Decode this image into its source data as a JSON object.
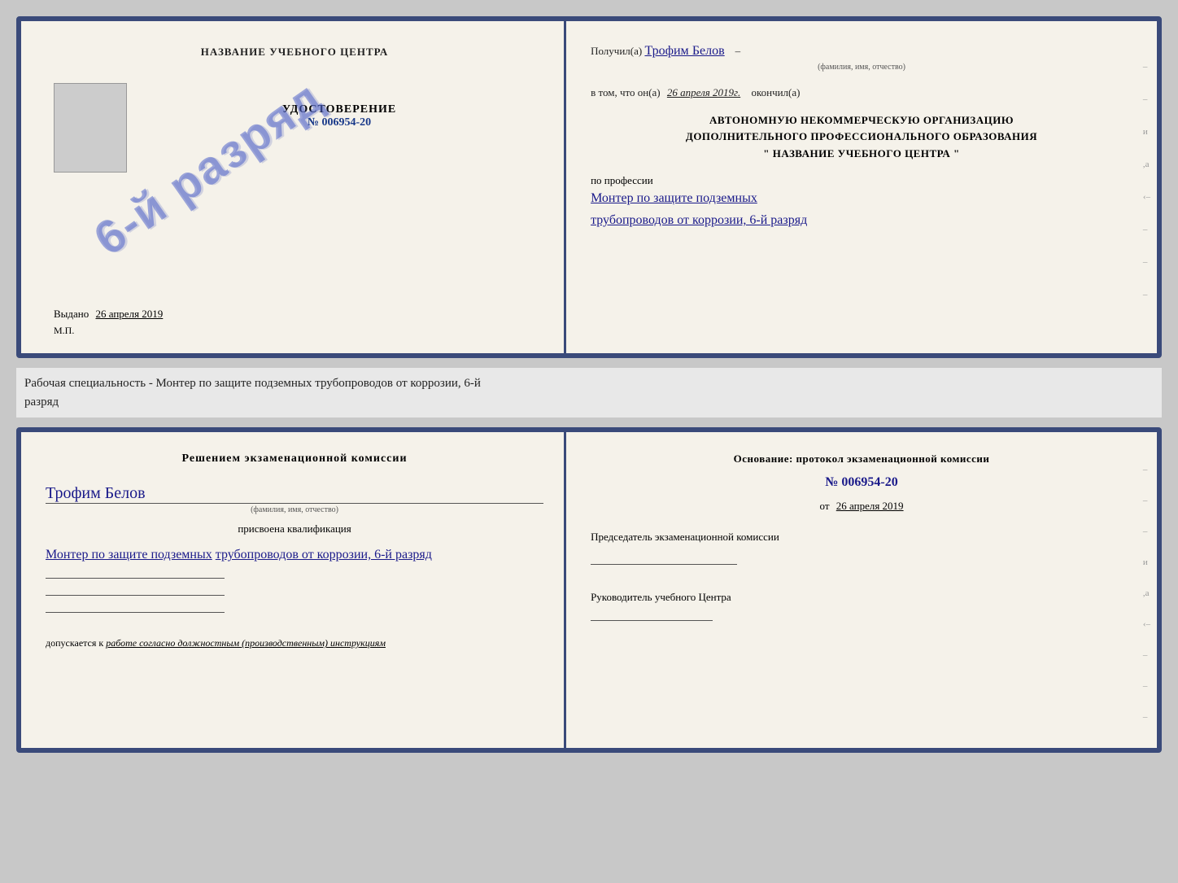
{
  "page": {
    "background": "#c8c8c8"
  },
  "top_cert": {
    "left": {
      "title": "НАЗВАНИЕ УЧЕБНОГО ЦЕНТРА",
      "stamp_text": "6-й разряд",
      "udostoverenie_label": "УДОСТОВЕРЕНИЕ",
      "number": "№ 006954-20",
      "vydano_label": "Выдано",
      "vydano_date": "26 апреля 2019",
      "mp_label": "М.П."
    },
    "right": {
      "poluchil_label": "Получил(a)",
      "recipient_name": "Трофим Белов",
      "fio_caption": "(фамилия, имя, отчество)",
      "vtom_label": "в том, что он(а)",
      "date_value": "26 апреля 2019г.",
      "okonchil_label": "окончил(а)",
      "org_line1": "АВТОНОМНУЮ НЕКОММЕРЧЕСКУЮ ОРГАНИЗАЦИЮ",
      "org_line2": "ДОПОЛНИТЕЛЬНОГО ПРОФЕССИОНАЛЬНОГО ОБРАЗОВАНИЯ",
      "org_quote": "\" НАЗВАНИЕ УЧЕБНОГО ЦЕНТРА \"",
      "po_professii": "по профессии",
      "profession_line1": "Монтер по защите подземных",
      "profession_line2": "трубопроводов от коррозии, 6-й разряд",
      "deco_chars": [
        "–",
        "–",
        "и",
        ",а",
        "‹–",
        "–",
        "–",
        "–"
      ]
    }
  },
  "middle_text": {
    "line1": "Рабочая специальность - Монтер по защите подземных трубопроводов от коррозии, 6-й",
    "line2": "разряд"
  },
  "bottom_cert": {
    "left": {
      "decision_title": "Решением экзаменационной комиссии",
      "name": "Трофим Белов",
      "fio_caption": "(фамилия, имя, отчество)",
      "prisvoena_label": "присвоена квалификация",
      "qual_line1": "Монтер по защите подземных",
      "qual_line2": "трубопроводов от коррозии, 6-й разряд",
      "dopuskaetsya_label": "допускается к",
      "work_text": "работе согласно должностным (производственным) инструкциям"
    },
    "right": {
      "osnov_label": "Основание: протокол экзаменационной комиссии",
      "protocol_number": "№ 006954-20",
      "ot_label": "от",
      "ot_date": "26 апреля 2019",
      "predsedatel_label": "Председатель экзаменационной комиссии",
      "rukovod_label": "Руководитель учебного Центра",
      "deco_chars": [
        "–",
        "–",
        "–",
        "и",
        ",а",
        "‹–",
        "–",
        "–",
        "–",
        "–"
      ]
    }
  }
}
